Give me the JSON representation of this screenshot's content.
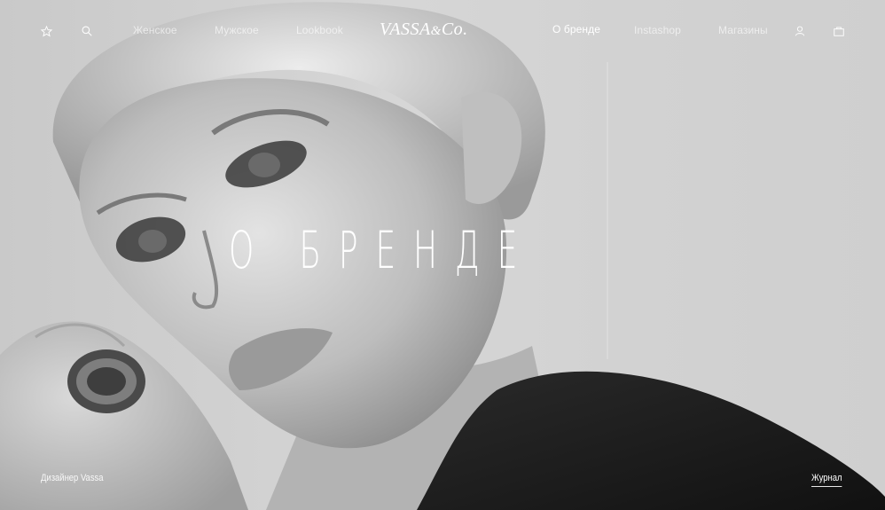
{
  "nav": {
    "women": "Женское",
    "men": "Мужское",
    "lookbook": "Lookbook",
    "logo_main": "VASSA",
    "logo_amp": "&",
    "logo_co": "Co.",
    "about": "О бренде",
    "instashop": "Instashop",
    "stores": "Магазины"
  },
  "icons": {
    "favorites": "star-icon",
    "search": "search-icon",
    "account": "user-icon",
    "cart": "bag-icon"
  },
  "hero": {
    "title": "О БРЕНДЕ",
    "caption": "Дизайнер Vassa",
    "journal_link": "Журнал"
  },
  "colors": {
    "text": "#ffffff",
    "text_muted": "#e6e6e6"
  }
}
